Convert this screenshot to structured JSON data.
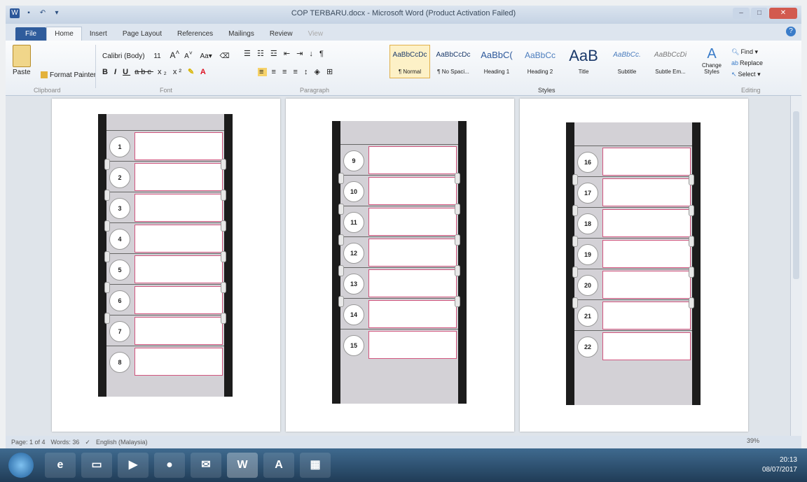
{
  "window": {
    "title": "COP TERBARU.docx - Microsoft Word (Product Activation Failed)"
  },
  "tabs": [
    "File",
    "Home",
    "Insert",
    "Page Layout",
    "References",
    "Mailings",
    "Review",
    "View"
  ],
  "clipboard": {
    "paste": "Paste",
    "format_painter": "Format Painter",
    "group": "Clipboard"
  },
  "font": {
    "name": "Calibri (Body)",
    "size": "11",
    "group": "Font"
  },
  "paragraph": {
    "group": "Paragraph"
  },
  "styles": {
    "group": "Styles",
    "items": [
      {
        "preview": "AaBbCcDc",
        "name": "¶ Normal"
      },
      {
        "preview": "AaBbCcDc",
        "name": "¶ No Spaci..."
      },
      {
        "preview": "AaBbC(",
        "name": "Heading 1"
      },
      {
        "preview": "AaBbCc",
        "name": "Heading 2"
      },
      {
        "preview": "AaB",
        "name": "Title"
      },
      {
        "preview": "AaBbCc.",
        "name": "Subtitle"
      },
      {
        "preview": "AaBbCcDi",
        "name": "Subtle Em..."
      }
    ],
    "change": "Change Styles"
  },
  "editing": {
    "find": "Find",
    "replace": "Replace",
    "select": "Select",
    "group": "Editing"
  },
  "pages": [
    {
      "numbers": [
        "1",
        "2",
        "3",
        "4",
        "5",
        "6",
        "7",
        "8"
      ]
    },
    {
      "numbers": [
        "9",
        "10",
        "11",
        "12",
        "13",
        "14",
        "15"
      ]
    },
    {
      "numbers": [
        "16",
        "17",
        "18",
        "19",
        "20",
        "21",
        "22"
      ]
    }
  ],
  "status": {
    "page": "Page: 1 of 4",
    "words": "Words: 36",
    "language": "English (Malaysia)",
    "zoom": "39%"
  },
  "taskbar": {
    "time": "20:13",
    "date": "08/07/2017"
  }
}
